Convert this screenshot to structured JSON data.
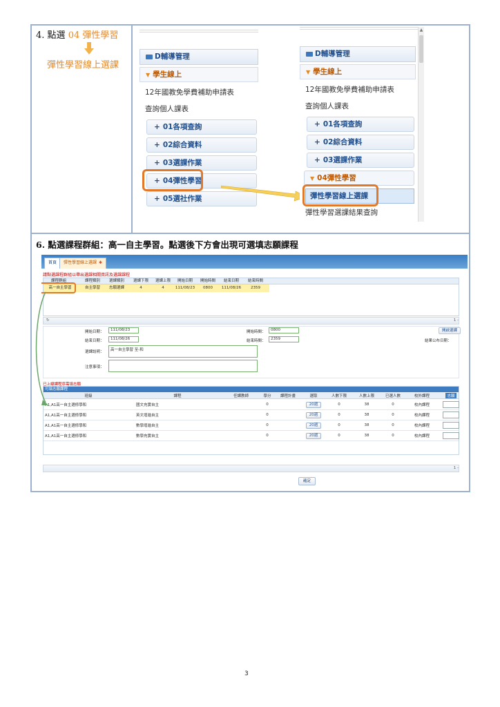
{
  "step4": {
    "title_prefix": "4. 點選",
    "title_highlight": "04 彈性學習",
    "subtitle": "彈性學習線上選課"
  },
  "menu_before": {
    "group": "D輔導管理",
    "section": "學生線上",
    "link1": "12年國教免學費補助申請表",
    "link2": "查詢個人課表",
    "items": [
      "01各項查詢",
      "02綜合資料",
      "03選課作業",
      "04彈性學習",
      "05選社作業"
    ]
  },
  "menu_after": {
    "group": "D輔導管理",
    "section": "學生線上",
    "link1": "12年國教免學費補助申請表",
    "link2": "查詢個人課表",
    "items": [
      "01各項查詢",
      "02綜合資料",
      "03選課作業"
    ],
    "open_item": "04彈性學習",
    "selected": "彈性學習線上選課",
    "next": "彈性學習選課結果查詢"
  },
  "step6": {
    "title": "6. 點選課程群組：高一自主學習。點選後下方會出現可選填志願課程"
  },
  "app": {
    "tabs": [
      "首頁",
      "彈性學習線上選課"
    ],
    "hint": "請點選課程群組以帶出選課相關資訊及選課課程",
    "group_headers": [
      "課程群組",
      "課程類別",
      "選課類別",
      "選課下限",
      "選課上限",
      "開始日期",
      "開始時間",
      "結束日期",
      "結束時間"
    ],
    "group_row": [
      "高一自主學習",
      "自主學習",
      "志願選課",
      "4",
      "4",
      "111/08/23",
      "0800",
      "111/08/26",
      "2359"
    ],
    "pager_right": "1 -",
    "form": {
      "start_date_label": "開始日期：",
      "start_date": "111/08/23",
      "start_time_label": "開始時間：",
      "start_time": "0800",
      "end_date_label": "結束日期：",
      "end_date": "111/08/26",
      "end_time_label": "結束時間：",
      "end_time": "2359",
      "class_label": "選課說明：",
      "class_value": "高一自主學習 至-和",
      "note_label": "注意事項：",
      "button": "開啟選課",
      "announce_label": "結果公布日期："
    },
    "red_note": "已上線課程序需填志願",
    "course_title": "可填志願課程",
    "course_headers": [
      "班級",
      "課程",
      "任課教師",
      "學分",
      "課程計畫",
      "選取",
      "人數下限",
      "人數上限",
      "已選人數",
      "校外課程",
      "志願"
    ],
    "courses": [
      [
        "A1,A1高一自主選修學和",
        "國文充實自主",
        "",
        "0",
        "",
        "20週",
        "0",
        "38",
        "0",
        "校內課程"
      ],
      [
        "A1,A1高一自主選修學和",
        "英文增進自主",
        "",
        "0",
        "",
        "20週",
        "0",
        "38",
        "0",
        "校內課程"
      ],
      [
        "A1,A1高一自主選修學和",
        "數學增進自主",
        "",
        "0",
        "",
        "20週",
        "0",
        "38",
        "0",
        "校內課程"
      ],
      [
        "A1,A1高一自主選修學和",
        "數學充實自主",
        "",
        "0",
        "",
        "20週",
        "0",
        "38",
        "0",
        "校內課程"
      ]
    ],
    "bottom_pager": "1 -",
    "ok_button": "確定"
  },
  "page_number": "3",
  "colors": {
    "accent_orange": "#e07a2a",
    "menu_blue": "#1f4f8f",
    "header_blue": "#3a7ec4"
  }
}
